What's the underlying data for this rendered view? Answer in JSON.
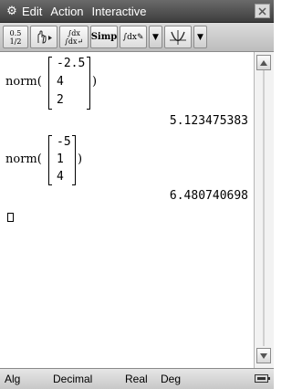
{
  "menubar": {
    "settings_icon": "gear-icon",
    "items": [
      "Edit",
      "Action",
      "Interactive"
    ]
  },
  "toolbar": {
    "frac_top": "0.5",
    "frac_bottom": "1/2",
    "simp_label": "Simp",
    "integral_label": "∫dx",
    "drop_arrow": "▼"
  },
  "entries": [
    {
      "func": "norm",
      "vector": [
        "-2.5",
        "4",
        "2"
      ],
      "result": "5.123475383"
    },
    {
      "func": "norm",
      "vector": [
        "-5",
        "1",
        "4"
      ],
      "result": "6.480740698"
    }
  ],
  "status": {
    "mode": "Alg",
    "format": "Decimal",
    "domain": "Real",
    "angle": "Deg"
  }
}
